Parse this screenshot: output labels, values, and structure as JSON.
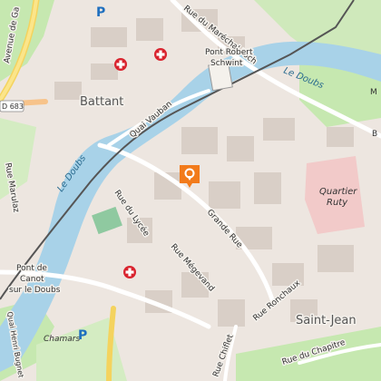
{
  "map": {
    "districts": {
      "battant": "Battant",
      "saint_jean": "Saint-Jean",
      "quartier_ruty_line1": "Quartier",
      "quartier_ruty_line2": "Ruty"
    },
    "river": {
      "name_north": "Le Doubs",
      "name_west": "Le Doubs"
    },
    "streets": {
      "avenue_gaulle": "Avenue de Ga",
      "rue_marechal_foch": "Rue du Maréchal Foch",
      "quai_vauban": "Quai Vauban",
      "rue_lycee": "Rue du Lycée",
      "grande_rue": "Grande Rue",
      "rue_megevand": "Rue Mégevand",
      "rue_ronchaux": "Rue Ronchaux",
      "rue_chiflet": "Rue Chiflet",
      "rue_chapitre": "Rue du Chapitre",
      "rue_marulaz": "Rue Marulaz",
      "rue_henri_bugnet": "Quai Henri Bugnet",
      "road_683": "D 683"
    },
    "bridges": {
      "pont_robert_line1": "Pont Robert",
      "pont_robert_line2": "Schwint",
      "pont_canot_line1": "Pont de",
      "pont_canot_line2": "Canot",
      "pont_canot_line3": "sur le Doubs"
    },
    "places": {
      "chamars": "Chamars",
      "parking_symbol": "P"
    },
    "edge_labels": {
      "right_b": "B",
      "right_m": "M"
    },
    "colors": {
      "river": "#a8d2e8",
      "park": "#c6e8b0",
      "buildings": "#d9cfc7",
      "hospital": "#d9232e",
      "marker": "#f27b1b",
      "parking": "#1e6fbf",
      "district_area": "#f2c4c4"
    }
  }
}
